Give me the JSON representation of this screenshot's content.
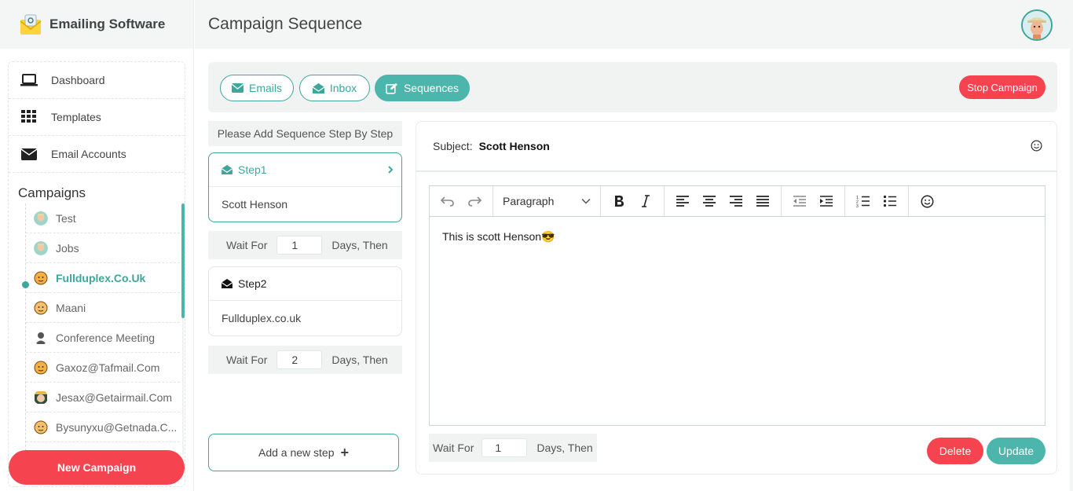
{
  "brand": {
    "name": "Emailing Software",
    "logo_icon": "envelope-at-logo-icon"
  },
  "header": {
    "title": "Campaign Sequence",
    "avatar": "user-avatar"
  },
  "sidebar": {
    "nav": [
      {
        "label": "Dashboard",
        "icon": "laptop-icon"
      },
      {
        "label": "Templates",
        "icon": "grid-icon"
      },
      {
        "label": "Email Accounts",
        "icon": "envelope-icon"
      }
    ],
    "campaigns_title": "Campaigns",
    "campaigns": [
      {
        "label": "Test",
        "active": false
      },
      {
        "label": "Jobs",
        "active": false
      },
      {
        "label": "Fullduplex.Co.Uk",
        "active": true
      },
      {
        "label": "Maani",
        "active": false
      },
      {
        "label": "Conference Meeting",
        "active": false
      },
      {
        "label": "Gaxoz@Tafmail.Com",
        "active": false
      },
      {
        "label": "Jesax@Getairmail.Com",
        "active": false
      },
      {
        "label": "Bysunyxu@Getnada.C...",
        "active": false
      }
    ],
    "new_campaign_label": "New Campaign"
  },
  "tabs": [
    {
      "label": "Emails",
      "icon": "envelope-icon",
      "active": false
    },
    {
      "label": "Inbox",
      "icon": "envelope-open-icon",
      "active": false
    },
    {
      "label": "Sequences",
      "icon": "edit-icon",
      "active": true
    }
  ],
  "stop_campaign_label": "Stop Campaign",
  "steps": {
    "hint": "Please Add Sequence Step By Step",
    "items": [
      {
        "title": "Step1",
        "subject": "Scott Henson",
        "active": true
      },
      {
        "title": "Step2",
        "subject": "Fullduplex.co.uk",
        "active": false
      }
    ],
    "waits": [
      {
        "label_before": "Wait For",
        "value": "1",
        "label_after": "Days, Then"
      },
      {
        "label_before": "Wait For",
        "value": "2",
        "label_after": "Days, Then"
      }
    ],
    "add_step_label": "Add a new step"
  },
  "editor": {
    "subject_label": "Subject:",
    "subject_value": "Scott Henson",
    "paragraph_select": "Paragraph",
    "body_text": "This is scott Henson",
    "body_emoji": "😎",
    "wait": {
      "label_before": "Wait For",
      "value": "1",
      "label_after": "Days, Then"
    },
    "delete_label": "Delete",
    "update_label": "Update"
  },
  "colors": {
    "accent": "#4db6ac",
    "accent_dark": "#3fa69c",
    "danger": "#f5434f",
    "panel_bg": "#f1f2f2"
  }
}
